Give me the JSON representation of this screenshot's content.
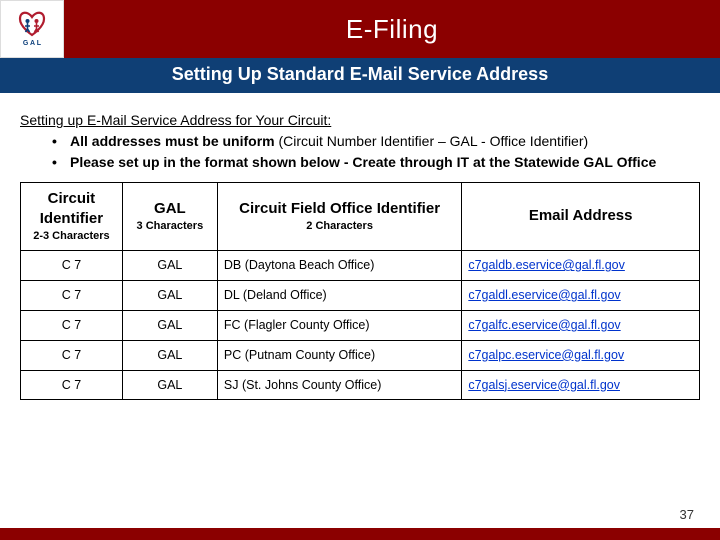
{
  "header": {
    "title": "E-Filing",
    "subtitle": "Setting Up Standard E-Mail Service Address"
  },
  "content": {
    "lead": "Setting up  E-Mail Service Address for Your Circuit:",
    "bullet1_bold": "All addresses must be uniform ",
    "bullet1_rest": "(Circuit Number Identifier – GAL - Office Identifier)",
    "bullet2": "Please set up in the format shown below - Create through IT at the Statewide GAL Office"
  },
  "table": {
    "headers": [
      {
        "main": "Circuit Identifier",
        "sub": "2-3 Characters"
      },
      {
        "main": "GAL",
        "sub": "3 Characters"
      },
      {
        "main": "Circuit Field Office Identifier",
        "sub": "2 Characters"
      },
      {
        "main": "Email Address",
        "sub": ""
      }
    ],
    "rows": [
      {
        "c0": "C 7",
        "c1": "GAL",
        "c2": "DB (Daytona Beach Office)",
        "c3": "c7galdb.eservice@gal.fl.gov"
      },
      {
        "c0": "C 7",
        "c1": "GAL",
        "c2": "DL (Deland Office)",
        "c3": "c7galdl.eservice@gal.fl.gov"
      },
      {
        "c0": "C 7",
        "c1": "GAL",
        "c2": "FC (Flagler County Office)",
        "c3": "c7galfc.eservice@gal.fl.gov"
      },
      {
        "c0": "C 7",
        "c1": "GAL",
        "c2": "PC (Putnam County Office)",
        "c3": "c7galpc.eservice@gal.fl.gov"
      },
      {
        "c0": "C 7",
        "c1": "GAL",
        "c2": "SJ (St. Johns County Office)",
        "c3": "c7galsj.eservice@gal.fl.gov"
      }
    ]
  },
  "page_number": "37"
}
